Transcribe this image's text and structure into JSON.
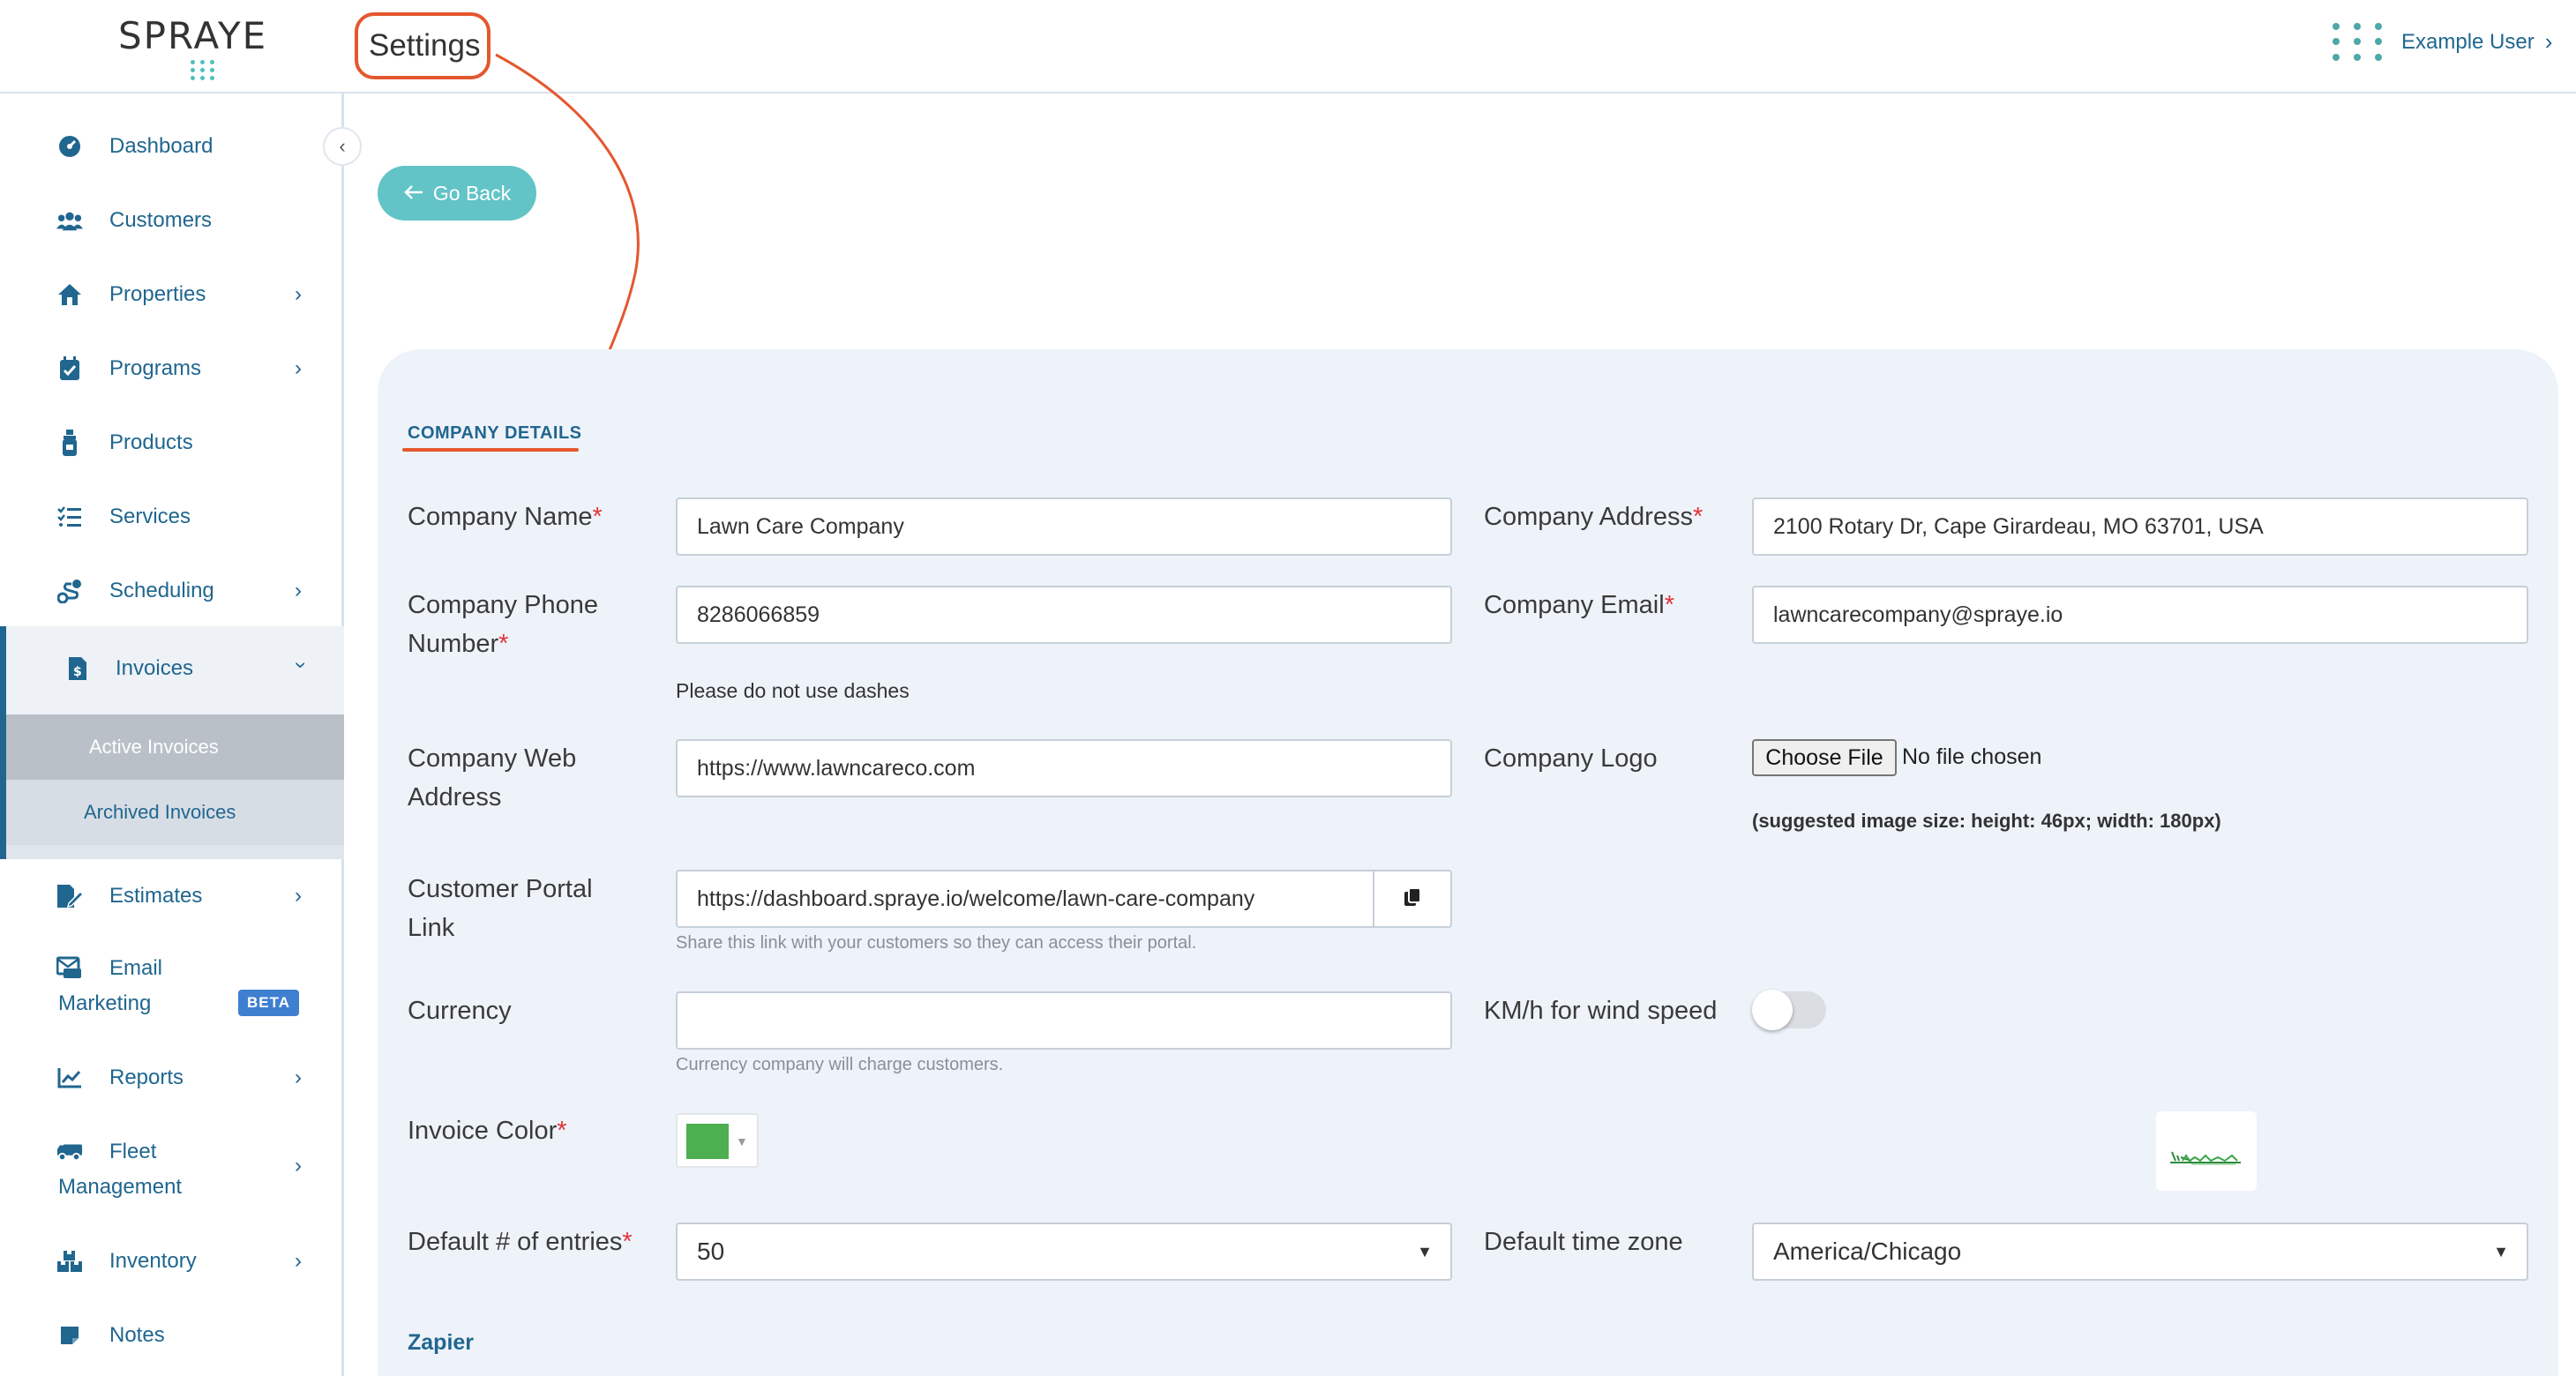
{
  "header": {
    "logo_text": "SPRAYE",
    "page_title": "Settings",
    "user_name": "Example User"
  },
  "sidebar": {
    "items": [
      {
        "label": "Dashboard",
        "icon": "dashboard-icon"
      },
      {
        "label": "Customers",
        "icon": "users-icon"
      },
      {
        "label": "Properties",
        "icon": "home-icon",
        "has_submenu": true
      },
      {
        "label": "Programs",
        "icon": "calendar-check-icon",
        "has_submenu": true
      },
      {
        "label": "Products",
        "icon": "spray-bottle-icon"
      },
      {
        "label": "Services",
        "icon": "list-icon"
      },
      {
        "label": "Scheduling",
        "icon": "route-icon",
        "has_submenu": true
      },
      {
        "label": "Invoices",
        "icon": "invoice-icon",
        "has_submenu": true,
        "expanded": true
      },
      {
        "label": "Estimates",
        "icon": "estimate-icon",
        "has_submenu": true
      },
      {
        "label_line1": "Email",
        "label_line2": "Marketing",
        "icon": "mail-icon",
        "badge": "BETA"
      },
      {
        "label": "Reports",
        "icon": "chart-line-icon",
        "has_submenu": true
      },
      {
        "label_line1": "Fleet",
        "label_line2": "Management",
        "icon": "truck-icon",
        "has_submenu": true
      },
      {
        "label": "Inventory",
        "icon": "boxes-icon",
        "has_submenu": true
      },
      {
        "label": "Notes",
        "icon": "note-icon"
      }
    ],
    "invoices_submenu": [
      {
        "label": "Active Invoices",
        "active": true
      },
      {
        "label": "Archived Invoices",
        "active": false
      }
    ]
  },
  "main": {
    "go_back_label": "Go Back",
    "section_title": "COMPANY DETAILS",
    "fields": {
      "company_name": {
        "label": "Company Name",
        "value": "Lawn Care Company",
        "required": true
      },
      "company_address": {
        "label": "Company Address",
        "value": "2100 Rotary Dr, Cape Girardeau, MO 63701, USA",
        "required": true
      },
      "company_phone": {
        "label_line1": "Company Phone",
        "label_line2": "Number",
        "value": "8286066859",
        "required": true,
        "hint": "Please do not use dashes"
      },
      "company_email": {
        "label": "Company Email",
        "value": "lawncarecompany@spraye.io",
        "required": true
      },
      "company_web": {
        "label_line1": "Company Web",
        "label_line2": "Address",
        "value": "https://www.lawncareco.com"
      },
      "company_logo": {
        "label": "Company Logo",
        "button": "Choose File",
        "status": "No file chosen",
        "hint": "(suggested image size: height: 46px; width: 180px)"
      },
      "portal_link": {
        "label_line1": "Customer Portal",
        "label_line2": "Link",
        "value": "https://dashboard.spraye.io/welcome/lawn-care-company",
        "hint": "Share this link with your customers so they can access their portal."
      },
      "currency": {
        "label": "Currency",
        "value": "",
        "hint": "Currency company will charge customers."
      },
      "kmh_wind": {
        "label": "KM/h for wind speed",
        "enabled": false
      },
      "invoice_color": {
        "label": "Invoice Color",
        "required": true,
        "color": "#4caf50"
      },
      "default_entries": {
        "label": "Default # of entries",
        "required": true,
        "value": "50"
      },
      "default_timezone": {
        "label": "Default time zone",
        "value": "America/Chicago"
      }
    },
    "zapier_label": "Zapier"
  },
  "colors": {
    "brand_blue": "#20668f",
    "accent_teal": "#62c4c6",
    "annotation_red": "#e4572e",
    "required_red": "#e0353b",
    "card_bg": "#eef3fa"
  }
}
